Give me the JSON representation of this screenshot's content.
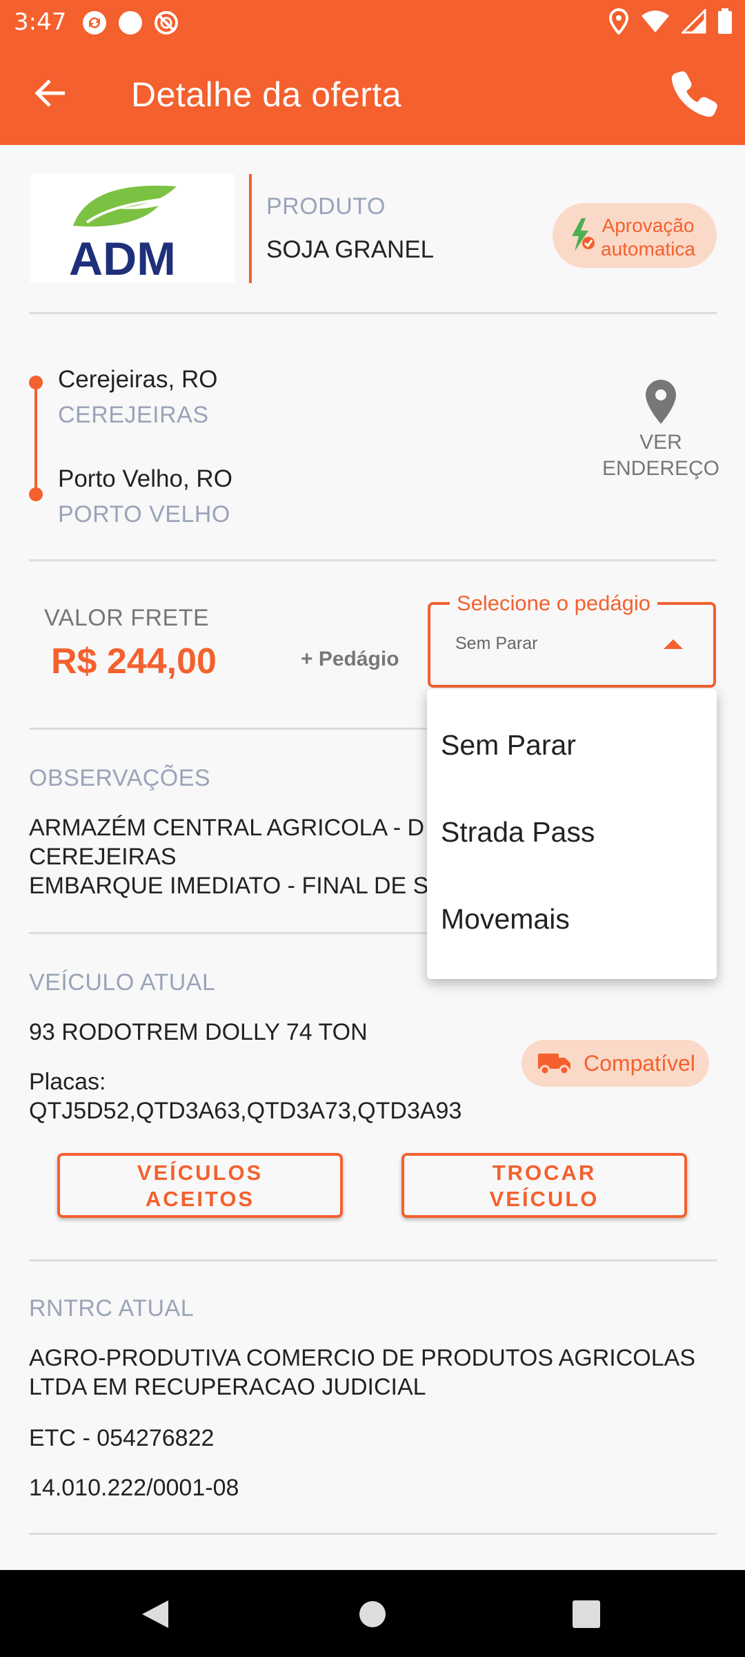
{
  "status_bar": {
    "time": "3:47"
  },
  "app_bar": {
    "title": "Detalhe da oferta"
  },
  "product": {
    "logo_text": "ADM",
    "label": "PRODUTO",
    "value": "SOJA GRANEL",
    "badge_line1": "Aprovação",
    "badge_line2": "automatica"
  },
  "route": {
    "origin_city": "Cerejeiras, RO",
    "origin_sub": "CEREJEIRAS",
    "destination_city": "Porto Velho, RO",
    "destination_sub": "PORTO VELHO",
    "view_address_line1": "VER",
    "view_address_line2": "ENDEREÇO"
  },
  "freight": {
    "label": "VALOR FRETE",
    "value": "R$ 244,00",
    "toll_suffix": "+ Pedágio",
    "select_label": "Selecione o pedágio",
    "select_value": "Sem Parar"
  },
  "dropdown": {
    "options": [
      "Sem Parar",
      "Strada Pass",
      "Movemais"
    ]
  },
  "observations": {
    "label": "OBSERVAÇÕES",
    "line1": "ARMAZÉM CENTRAL AGRICOLA - D",
    "line2": "CEREJEIRAS",
    "line3": "EMBARQUE IMEDIATO - FINAL DE S"
  },
  "vehicle": {
    "label": "VEÍCULO ATUAL",
    "name": "93 RODOTREM DOLLY 74 TON",
    "plates_label": "Placas:",
    "plates": "QTJ5D52,QTD3A63,QTD3A73,QTD3A93",
    "compat_badge": "Compatível",
    "btn_accepted_line1": "VEÍCULOS",
    "btn_accepted_line2": "ACEITOS",
    "btn_change_line1": "TROCAR",
    "btn_change_line2": "VEÍCULO"
  },
  "rntrc": {
    "label": "RNTRC ATUAL",
    "company_line1": "AGRO-PRODUTIVA COMERCIO DE PRODUTOS AGRICOLAS",
    "company_line2": "LTDA EM RECUPERACAO JUDICIAL",
    "etc": "ETC - 054276822",
    "cnpj": "14.010.222/0001-08"
  },
  "colors": {
    "accent": "#f4602e",
    "badge_bg": "#fbd9c8",
    "muted": "#9aa3b8",
    "logo_green": "#7cc242",
    "logo_blue": "#1f2f7a"
  }
}
